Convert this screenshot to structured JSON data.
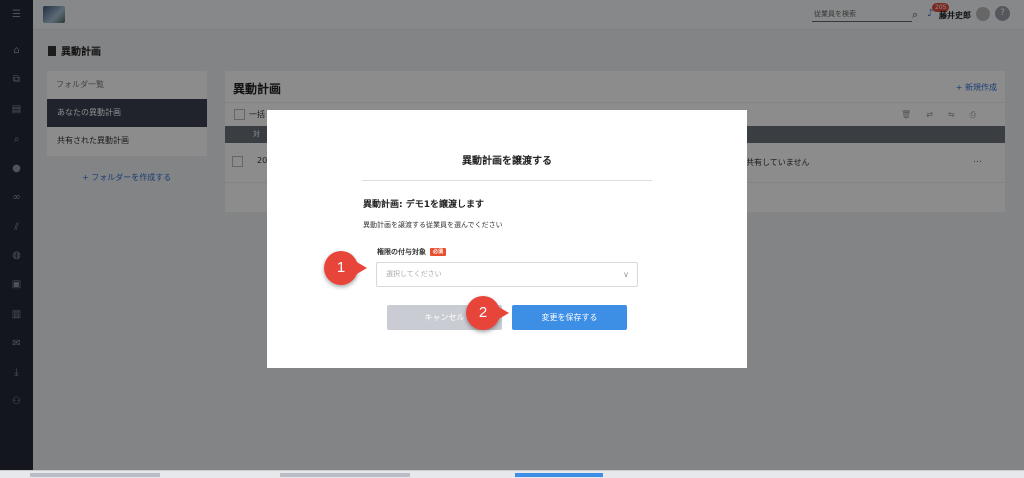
{
  "header": {
    "search_placeholder": "従業員を検索",
    "notification_count": "205",
    "user_name": "藤井史郎",
    "help": "?"
  },
  "page": {
    "title": "異動計画"
  },
  "folders": {
    "header": "フォルダ一覧",
    "items": [
      {
        "label": "あなたの異動計画",
        "active": true
      },
      {
        "label": "共有された異動計画",
        "active": false
      }
    ],
    "create_label": "+ フォルダーを作成する"
  },
  "main": {
    "title": "異動計画",
    "new_label": "+ 新規作成",
    "bulk_label": "一括",
    "table_header_fragment": "対",
    "row": {
      "year_fragment": "20",
      "share_status": "共有していません",
      "more": "…"
    }
  },
  "modal": {
    "title": "異動計画を譲渡する",
    "heading": "異動計画: デモ1を譲渡します",
    "description": "異動計画を譲渡する従業員を選んでください",
    "field_label": "権限の付与対象",
    "required_badge": "必須",
    "select_placeholder": "選択してください",
    "cancel_label": "キャンセル",
    "save_label": "変更を保存する"
  },
  "callouts": [
    "1",
    "2"
  ],
  "colors": {
    "sidebar": "#232a36",
    "accent": "#3d8fe6",
    "callout": "#e8453a",
    "required": "#e8512f"
  }
}
